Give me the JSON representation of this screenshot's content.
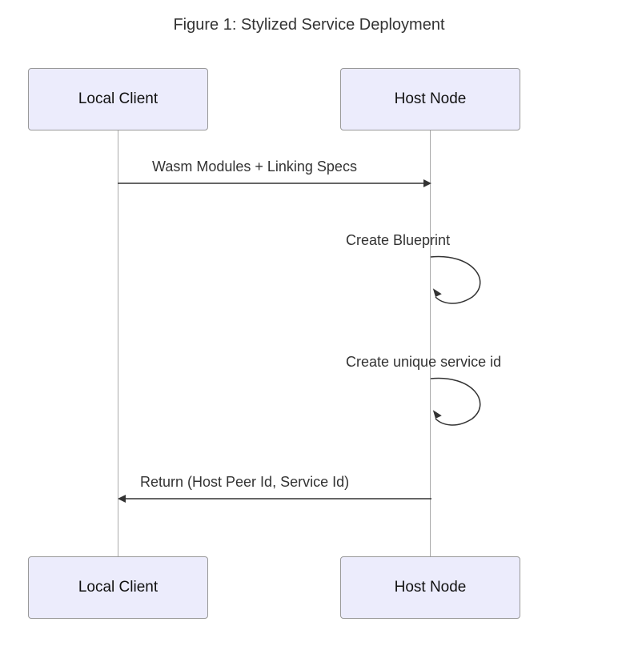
{
  "title": "Figure 1: Stylized Service Deployment",
  "actors": {
    "left": "Local Client",
    "right": "Host Node"
  },
  "messages": {
    "msg1": "Wasm Modules + Linking Specs",
    "self1": "Create Blueprint",
    "self2": "Create unique service id",
    "msg2": "Return (Host Peer Id, Service Id)"
  }
}
